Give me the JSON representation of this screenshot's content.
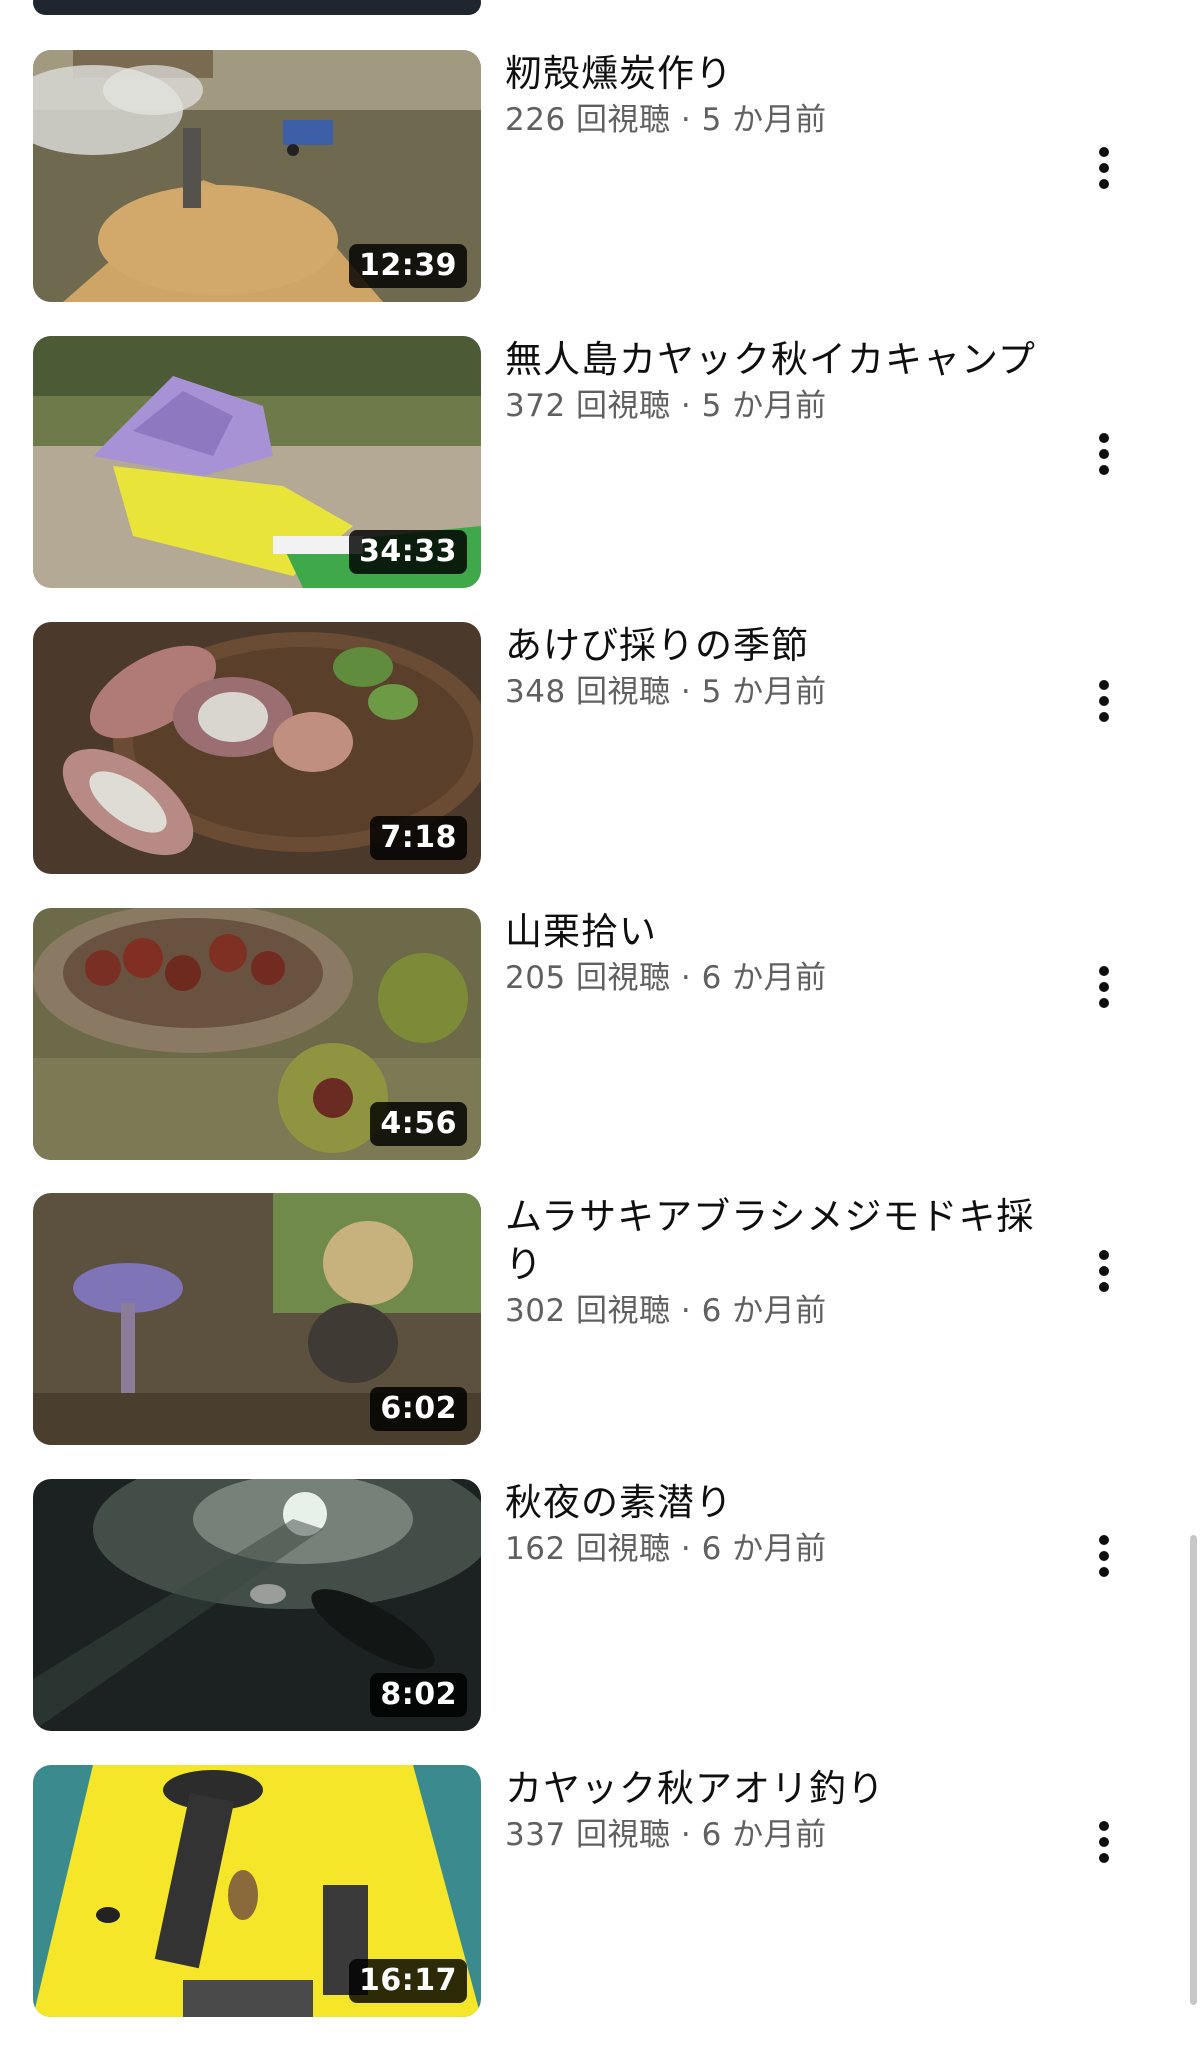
{
  "videos": [
    {
      "title": "籾殻燻炭作り",
      "views": "226 回視聴",
      "age": "5 か月前",
      "duration": "12:39",
      "thumbnail_icon": "rice-husk-charcoal-thumbnail"
    },
    {
      "title": "無人島カヤック秋イカキャンプ",
      "views": "372 回視聴",
      "age": "5 か月前",
      "duration": "34:33",
      "thumbnail_icon": "tent-kayak-thumbnail"
    },
    {
      "title": "あけび採りの季節",
      "views": "348 回視聴",
      "age": "5 か月前",
      "duration": "7:18",
      "thumbnail_icon": "akebi-basket-thumbnail"
    },
    {
      "title": "山栗拾い",
      "views": "205 回視聴",
      "age": "6 か月前",
      "duration": "4:56",
      "thumbnail_icon": "chestnut-basket-thumbnail"
    },
    {
      "title": "ムラサキアブラシメジモドキ採り",
      "views": "302 回視聴",
      "age": "6 か月前",
      "duration": "6:02",
      "thumbnail_icon": "purple-mushroom-thumbnail"
    },
    {
      "title": "秋夜の素潜り",
      "views": "162 回視聴",
      "age": "6 か月前",
      "duration": "8:02",
      "thumbnail_icon": "night-dive-thumbnail"
    },
    {
      "title": "カヤック秋アオリ釣り",
      "views": "337 回視聴",
      "age": "6 か月前",
      "duration": "16:17",
      "thumbnail_icon": "kayak-squid-fishing-thumbnail"
    }
  ],
  "separator": "·",
  "menu_icon": "more-vert-icon",
  "colors": {
    "title": "#0f0f0f",
    "meta": "#606060",
    "duration_bg": "#000000",
    "duration_text": "#ffffff",
    "background": "#ffffff"
  }
}
